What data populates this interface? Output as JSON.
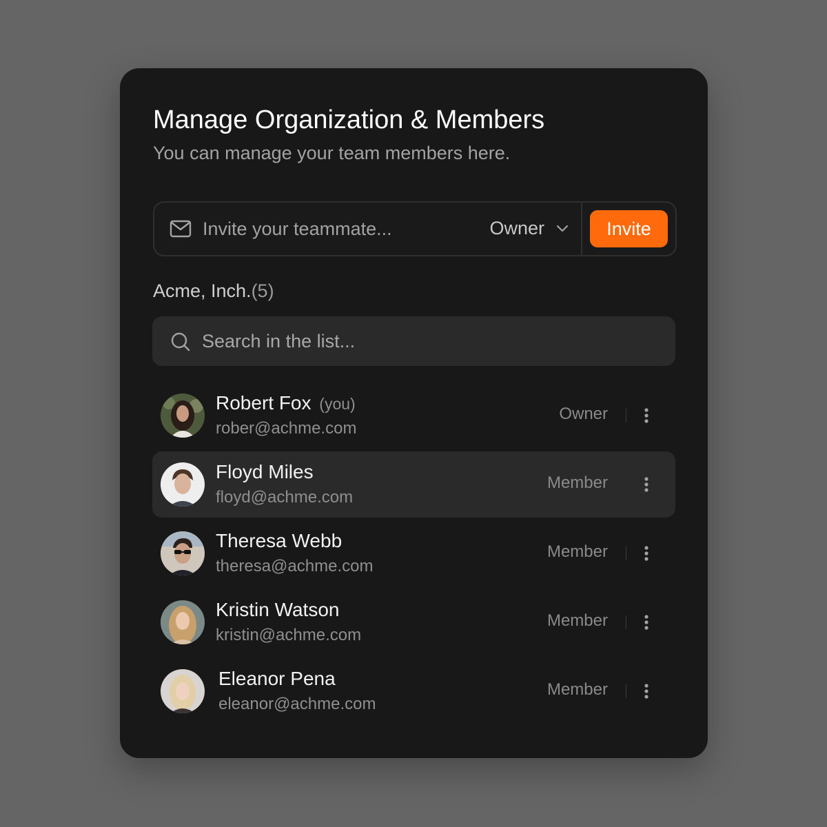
{
  "colors": {
    "page_background": "#656565",
    "card_background": "#181818",
    "accent": "#ff6a0c",
    "active_row": "#2a2a2a",
    "muted_text": "#8f8f8f"
  },
  "header": {
    "title": "Manage Organization & Members",
    "subtitle": "You can manage your team members here."
  },
  "invite": {
    "icon": "mail-icon",
    "placeholder": "Invite your teammate...",
    "value": "",
    "role_selected": "Owner",
    "dropdown_icon": "chevron-down-icon",
    "button_label": "Invite"
  },
  "organization": {
    "name": "Acme, Inch.",
    "count": "(5)"
  },
  "search": {
    "icon": "search-icon",
    "placeholder": "Search in the list...",
    "value": ""
  },
  "members": [
    {
      "name": "Robert Fox",
      "you_label": "(you)",
      "email": "rober@achme.com",
      "role": "Owner",
      "avatar_icon": "avatar-photo",
      "menu_icon": "more-vertical-icon",
      "highlighted": false
    },
    {
      "name": "Floyd Miles",
      "you_label": "",
      "email": "floyd@achme.com",
      "role": "Member",
      "avatar_icon": "avatar-photo",
      "menu_icon": "more-vertical-icon",
      "highlighted": true
    },
    {
      "name": "Theresa Webb",
      "you_label": "",
      "email": "theresa@achme.com",
      "role": "Member",
      "avatar_icon": "avatar-photo",
      "menu_icon": "more-vertical-icon",
      "highlighted": false
    },
    {
      "name": "Kristin Watson",
      "you_label": "",
      "email": "kristin@achme.com",
      "role": "Member",
      "avatar_icon": "avatar-photo",
      "menu_icon": "more-vertical-icon",
      "highlighted": false
    },
    {
      "name": "Eleanor Pena",
      "you_label": "",
      "email": "eleanor@achme.com",
      "role": "Member",
      "avatar_icon": "avatar-photo",
      "menu_icon": "more-vertical-icon",
      "highlighted": false
    }
  ]
}
